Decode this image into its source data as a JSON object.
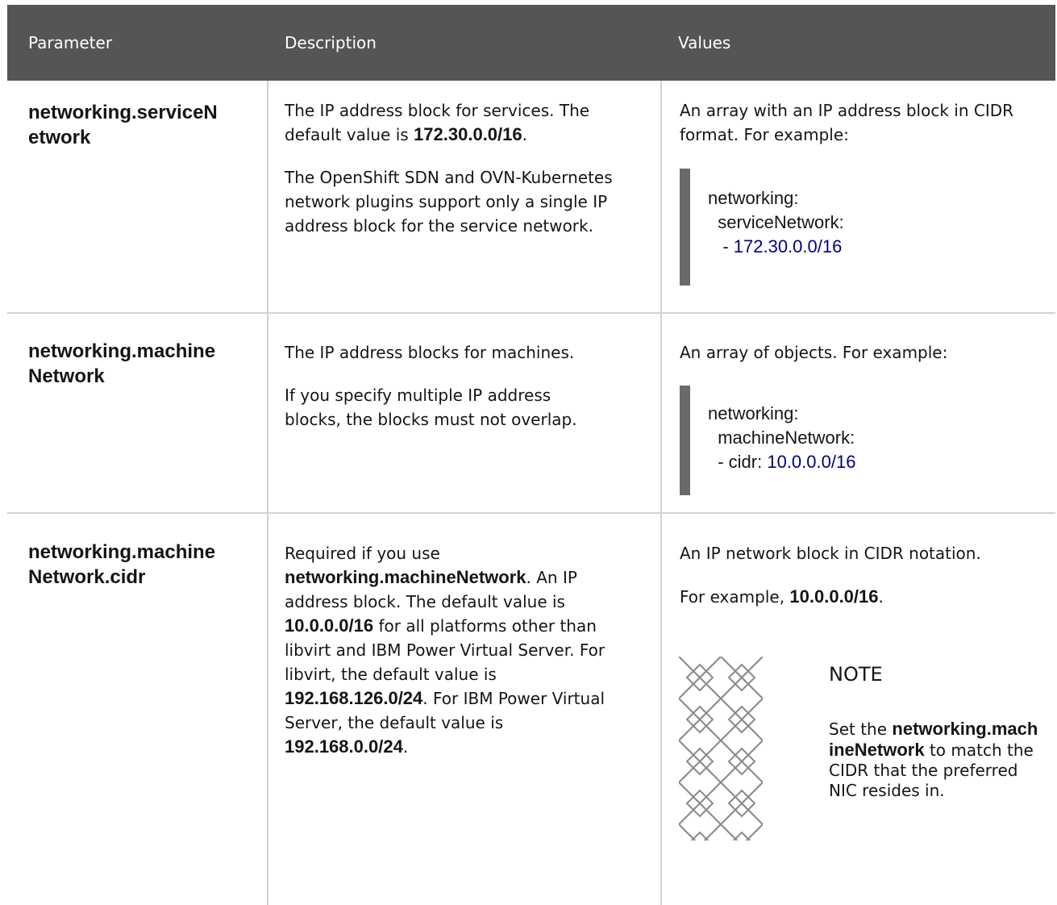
{
  "header": {
    "parameter": "Parameter",
    "description": "Description",
    "values": "Values"
  },
  "rows": [
    {
      "param_line1": "networking.serviceN",
      "param_line2": "etwork",
      "desc_p1_a": "The IP address block for services. The default value is ",
      "desc_p1_bold": "172.30.0.0/16",
      "desc_p1_end": ".",
      "desc_p2": "The OpenShift SDN and OVN-Kubernetes network plugins support only a single IP address block for the service network.",
      "value_intro": "An array with an IP address block in CIDR format. For example:",
      "code_l1": "networking:",
      "code_l2": "  serviceNetwork:",
      "code_l3_prefix": "   - ",
      "code_l3_num": "172.30.0.0/16"
    },
    {
      "param_line1": "networking.machine",
      "param_line2": "Network",
      "desc_p1": "The IP address blocks for machines.",
      "desc_p2": "If you specify multiple IP address blocks, the blocks must not overlap.",
      "value_intro": "An array of objects. For example:",
      "code_l1": "networking:",
      "code_l2": "  machineNetwork:",
      "code_l3_prefix": "  - cidr: ",
      "code_l3_num": "10.0.0.0/16"
    },
    {
      "param_line1": "networking.machine",
      "param_line2": "Network.cidr",
      "desc_a": "Required if you use ",
      "desc_b1": "networking.machineNetwork",
      "desc_c": ". An IP address block. The default value is ",
      "desc_b2": "10.0.0.0/16",
      "desc_d": " for all platforms other than libvirt and IBM Power Virtual Server. For libvirt, the default value is ",
      "desc_b3": "192.168.126.0/24",
      "desc_e": ". For IBM Power Virtual Server, the default value is ",
      "desc_b4": "192.168.0.0/24",
      "desc_f": ".",
      "value_p1": "An IP network block in CIDR notation.",
      "value_p2_a": "For example, ",
      "value_p2_bold": "10.0.0.0/16",
      "value_p2_end": ".",
      "note_title": "NOTE",
      "note_a": "Set the ",
      "note_bold": "networking.machineNetwork",
      "note_b": " to match the CIDR that the preferred NIC resides in."
    }
  ]
}
